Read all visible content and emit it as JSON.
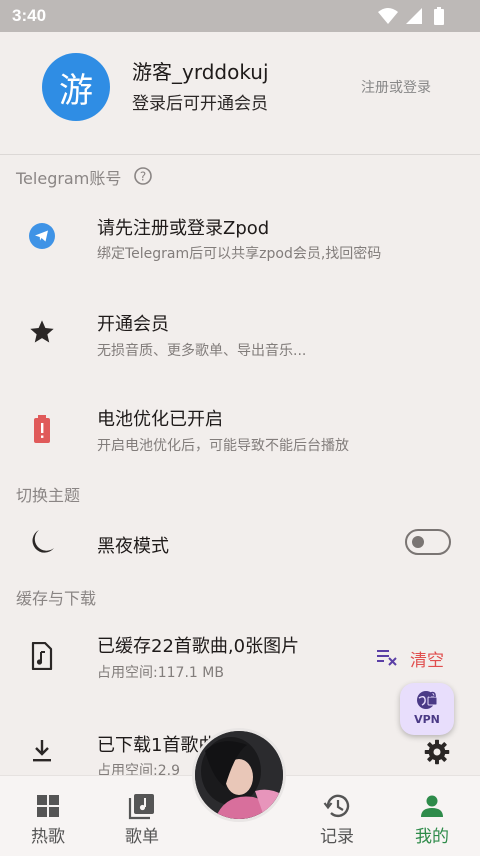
{
  "status_bar": {
    "time": "3:40",
    "icons": [
      "wifi-icon",
      "signal-icon",
      "battery-icon"
    ]
  },
  "profile": {
    "avatar_char": "游",
    "name": "游客_yrddokuj",
    "subtitle": "登录后可开通会员",
    "login_link": "注册或登录"
  },
  "telegram_section": {
    "title": "Telegram账号",
    "item": {
      "title": "请先注册或登录Zpod",
      "subtitle": "绑定Telegram后可以共享zpod会员,找回密码"
    }
  },
  "membership": {
    "title": "开通会员",
    "subtitle": "无损音质、更多歌单、导出音乐..."
  },
  "battery": {
    "title": "电池优化已开启",
    "subtitle": "开启电池优化后，可能导致不能后台播放"
  },
  "theme_section": {
    "title": "切换主题",
    "dark_mode": {
      "label": "黑夜模式",
      "enabled": false
    }
  },
  "cache_section": {
    "title": "缓存与下载",
    "cached": {
      "title": "已缓存22首歌曲,0张图片",
      "subtitle": "占用空间:117.1 MB",
      "clear_label": "清空"
    },
    "downloaded": {
      "title": "已下载1首歌曲",
      "subtitle": "占用空间:2.9"
    }
  },
  "vpn_button": {
    "label": "VPN"
  },
  "bottom_nav": {
    "items": [
      {
        "label": "热歌",
        "icon": "grid-icon"
      },
      {
        "label": "歌单",
        "icon": "music-library-icon"
      },
      {
        "label": "记录",
        "icon": "history-icon"
      },
      {
        "label": "我的",
        "icon": "person-icon"
      }
    ],
    "active_index": 3
  },
  "colors": {
    "accent_blue": "#2f8de4",
    "accent_green": "#2e8b4a",
    "clear_red": "#e04e4e",
    "battery_red": "#e05a5a"
  }
}
